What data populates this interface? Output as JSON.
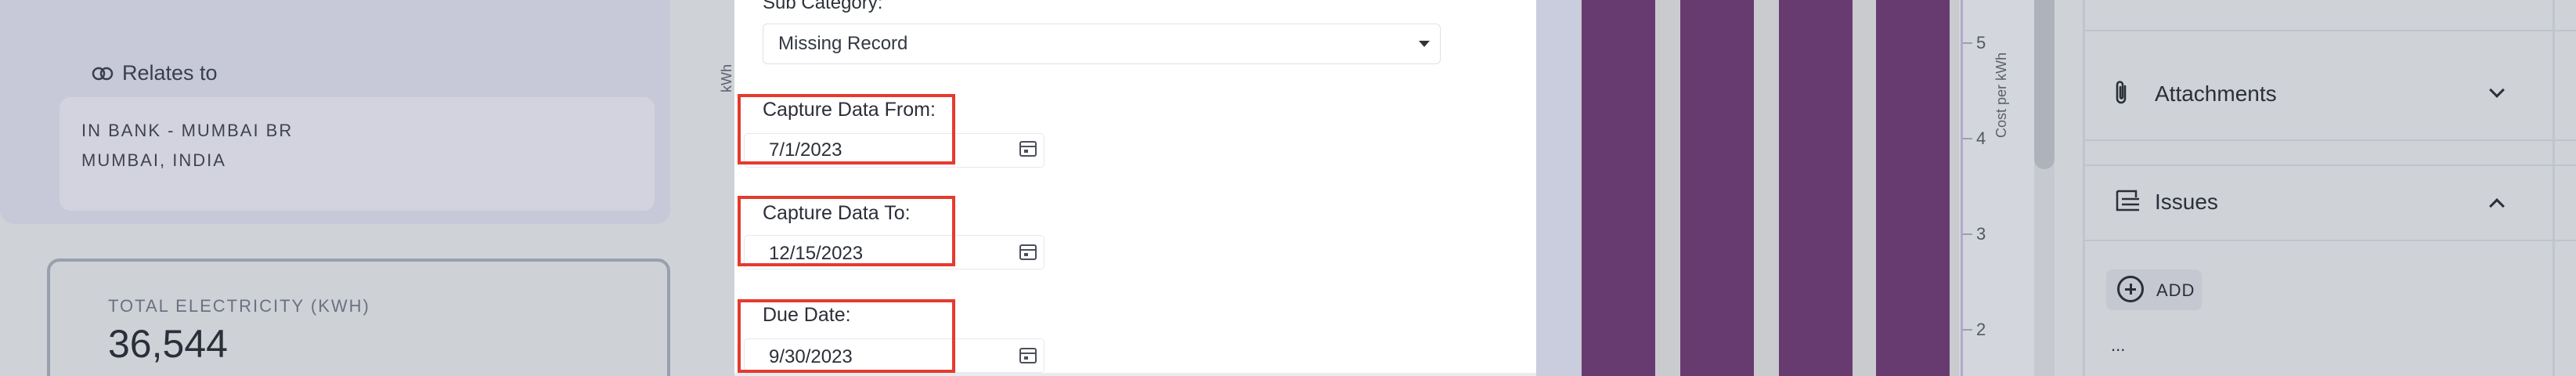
{
  "background_left": {
    "relates_to": {
      "title": "Relates to",
      "lines": [
        "IN BANK - MUMBAI BR",
        "MUMBAI, INDIA"
      ]
    },
    "total_electricity": {
      "label": "TOTAL ELECTRICITY (KWH)",
      "value": "36,544"
    }
  },
  "modal": {
    "sub_category": {
      "label": "Sub Category:",
      "value": "Missing Record"
    },
    "capture_from": {
      "label": "Capture Data From:",
      "value": "7/1/2023"
    },
    "capture_to": {
      "label": "Capture Data To:",
      "value": "12/15/2023"
    },
    "due_date": {
      "label": "Due Date:",
      "value": "9/30/2023"
    }
  },
  "chart": {
    "left_axis_label": "kWh",
    "right_axis_label": "Cost per kWh",
    "right_ticks": [
      "5",
      "4",
      "3",
      "2"
    ],
    "bar_color": "#683b70"
  },
  "sidebar": {
    "attachments": {
      "title": "Attachments",
      "expanded": false
    },
    "issues": {
      "title": "Issues",
      "expanded": true,
      "add_label": "ADD",
      "placeholder": "..."
    }
  },
  "colors": {
    "highlight_box": "#e53a2e",
    "modal_bg": "#ffffff"
  },
  "icons": [
    "link-icon",
    "chevron-down-icon",
    "calendar-icon",
    "paperclip-icon",
    "issues-list-icon",
    "chevron-up-icon",
    "plus-circle-icon"
  ]
}
